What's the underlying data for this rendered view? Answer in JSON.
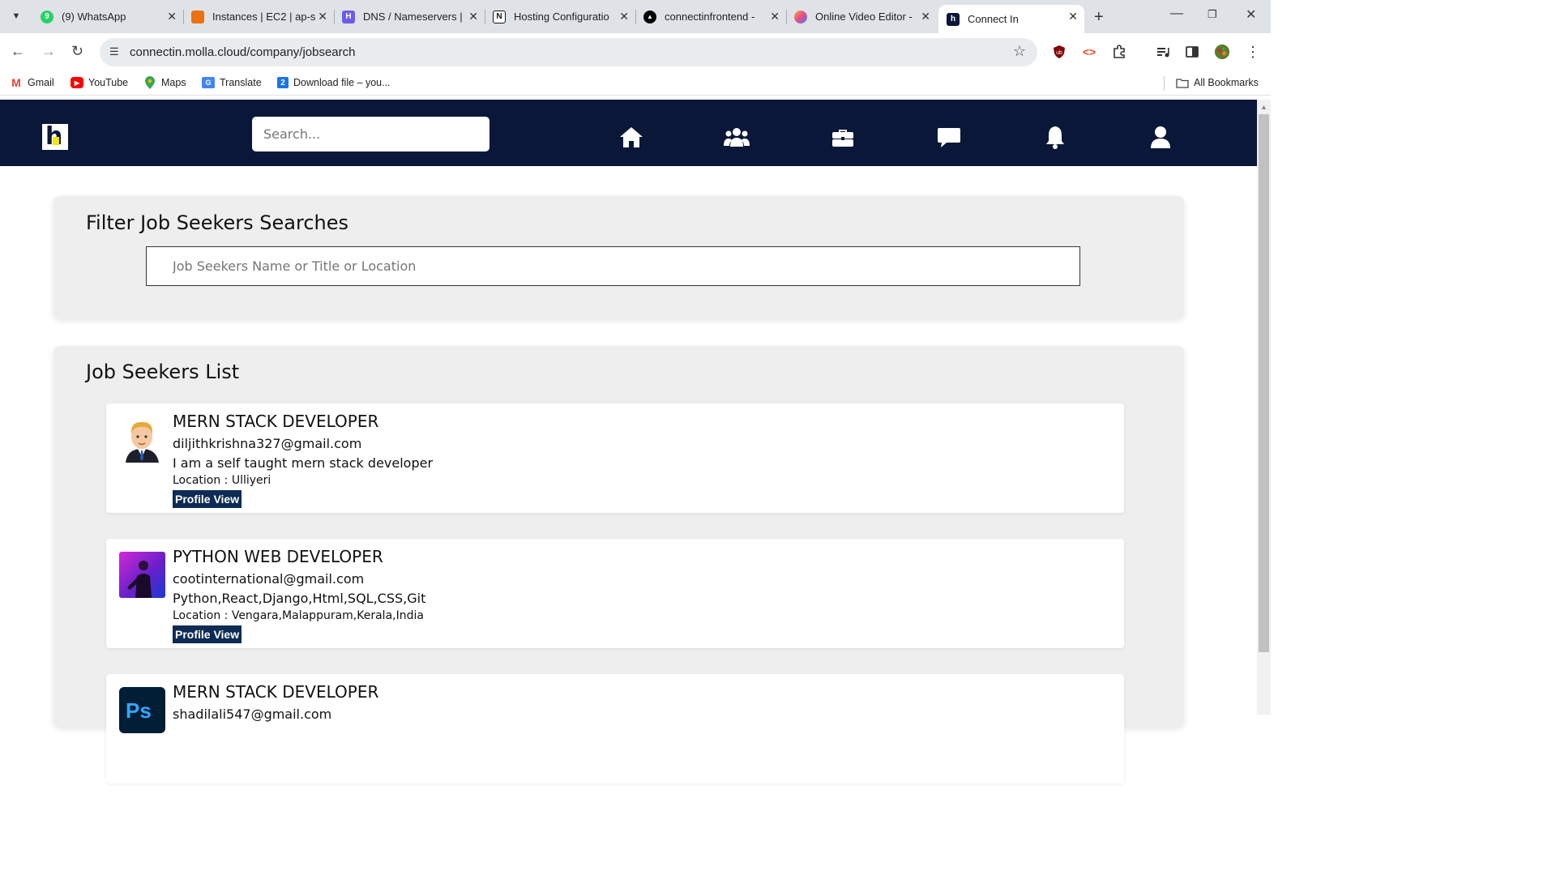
{
  "browser": {
    "tabs": [
      {
        "title": "(9) WhatsApp",
        "fav_color": "#25d366",
        "icon": "whatsapp-icon"
      },
      {
        "title": "Instances | EC2 | ap-s",
        "fav_color": "#ec7211",
        "icon": "aws-icon"
      },
      {
        "title": "DNS / Nameservers |",
        "fav_color": "#6c5ce7",
        "icon": "hostinger-icon"
      },
      {
        "title": "Hosting Configuratio",
        "fav_color": "#111111",
        "icon": "notion-icon"
      },
      {
        "title": "connectinfrontend - ",
        "fav_color": "#000000",
        "icon": "vercel-icon"
      },
      {
        "title": "Online Video Editor - ",
        "fav_color": "#f2a93b",
        "icon": "video-editor-icon"
      },
      {
        "title": "Connect In",
        "fav_color": "#0b1738",
        "icon": "connectin-icon",
        "active": true
      }
    ],
    "url": "connectin.molla.cloud/company/jobsearch",
    "bookmarks": [
      {
        "label": "Gmail",
        "color": "#ea4335"
      },
      {
        "label": "YouTube",
        "color": "#ff0000"
      },
      {
        "label": "Maps",
        "color": "#34a853"
      },
      {
        "label": "Translate",
        "color": "#4285f4"
      },
      {
        "label": "Download file – you...",
        "color": "#1a73e8"
      }
    ],
    "all_bookmarks": "All Bookmarks"
  },
  "site": {
    "search_placeholder": "Search...",
    "nav": [
      "home-icon",
      "network-icon",
      "jobs-icon",
      "messages-icon",
      "notifications-icon",
      "profile-icon"
    ],
    "header_color": "#0b1738"
  },
  "filter": {
    "heading": "Filter Job Seekers Searches",
    "placeholder": "Job Seekers Name or Title or Location"
  },
  "list": {
    "heading": "Job Seekers List",
    "seekers": [
      {
        "title": "MERN STACK DEVELOPER",
        "email": "diljithkrishna327@gmail.com",
        "about": "I am a self taught mern stack developer",
        "location": "Location : Ulliyeri",
        "button": "Profile View"
      },
      {
        "title": "PYTHON WEB DEVELOPER",
        "email": "cootinternational@gmail.com",
        "about": "Python,React,Django,Html,SQL,CSS,Git",
        "location": "Location : Vengara,Malappuram,Kerala,India",
        "button": "Profile View"
      },
      {
        "title": "MERN STACK DEVELOPER",
        "email": "shadilali547@gmail.com",
        "about": "",
        "location": "",
        "button": ""
      }
    ]
  }
}
